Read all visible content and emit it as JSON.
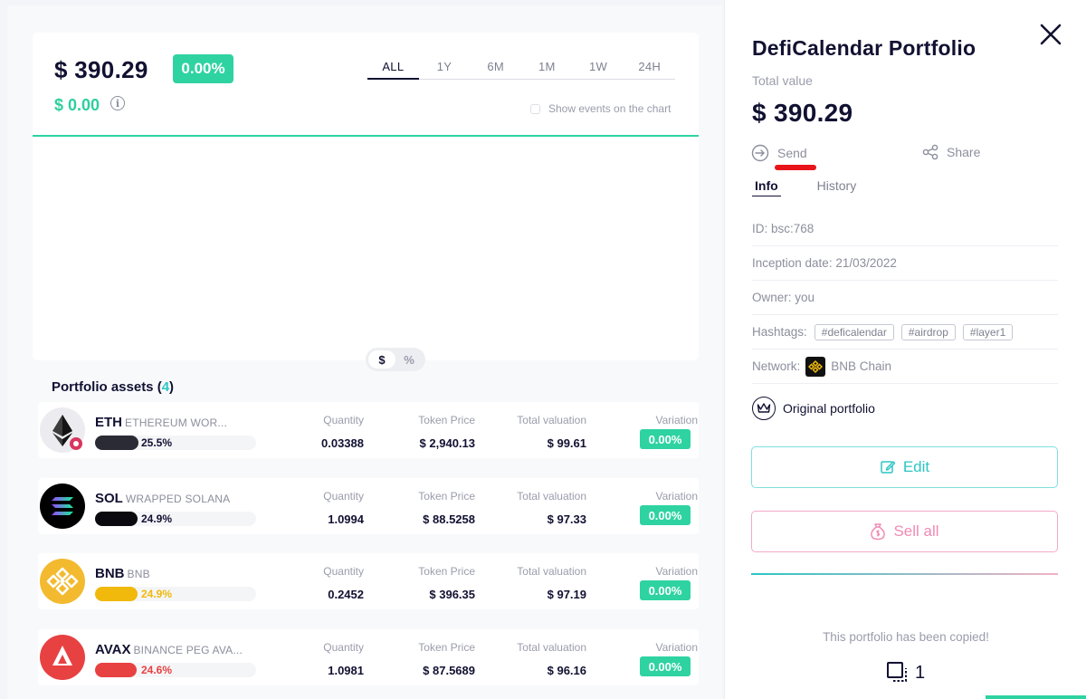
{
  "header": {
    "total_value": "$ 390.29",
    "change_pct": "0.00%",
    "change_value": "$ 0.00",
    "info_glyph": "i",
    "ranges": [
      "ALL",
      "1Y",
      "6M",
      "1M",
      "1W",
      "24H"
    ],
    "active_range": "ALL",
    "show_events_label": "Show events on the chart",
    "currency_toggle": [
      "$",
      "%"
    ],
    "active_toggle": "$"
  },
  "assets": {
    "title": "Portfolio assets",
    "count": "4",
    "col_labels": {
      "quantity": "Quantity",
      "token_price": "Token Price",
      "total_valuation": "Total valuation",
      "variation": "Variation"
    },
    "rows": [
      {
        "symbol": "ETH",
        "name": "ETHEREUM WOR...",
        "share": "25.5%",
        "share_value": 0.255,
        "share_color": "#2b2b36",
        "pct_color": "#111132",
        "quantity": "0.03388",
        "token_price": "$ 2,940.13",
        "total_valuation": "$ 99.61",
        "variation": "0.00%",
        "logo_icon": "ethereum-icon",
        "logo_bg": "#ececf0"
      },
      {
        "symbol": "SOL",
        "name": "WRAPPED SOLANA",
        "share": "24.9%",
        "share_value": 0.249,
        "share_color": "#0a0a0f",
        "pct_color": "#111132",
        "quantity": "1.0994",
        "token_price": "$ 88.5258",
        "total_valuation": "$ 97.33",
        "variation": "0.00%",
        "logo_icon": "solana-icon",
        "logo_bg": "#000000"
      },
      {
        "symbol": "BNB",
        "name": "BNB",
        "share": "24.9%",
        "share_value": 0.249,
        "share_color": "#f0b90b",
        "pct_color": "#f0b90b",
        "quantity": "0.2452",
        "token_price": "$ 396.35",
        "total_valuation": "$ 97.19",
        "variation": "0.00%",
        "logo_icon": "bnb-icon",
        "logo_bg": "#f3ba2f"
      },
      {
        "symbol": "AVAX",
        "name": "BINANCE PEG AVA...",
        "share": "24.6%",
        "share_value": 0.246,
        "share_color": "#e84142",
        "pct_color": "#e84142",
        "quantity": "1.0981",
        "token_price": "$ 87.5689",
        "total_valuation": "$ 96.16",
        "variation": "0.00%",
        "logo_icon": "avalanche-icon",
        "logo_bg": "#e84142"
      }
    ]
  },
  "panel": {
    "title": "DefiCalendar Portfolio",
    "total_label": "Total value",
    "total_value": "$ 390.29",
    "send_label": "Send",
    "share_label": "Share",
    "tabs": [
      "Info",
      "History"
    ],
    "info_rows": {
      "id": "ID: bsc:768",
      "inception": "Inception date: 21/03/2022",
      "owner": "Owner: you",
      "hashtags_label": "Hashtags:",
      "hashtags": [
        "#deficalendar",
        "#airdrop",
        "#layer1"
      ],
      "network_label": "Network:",
      "network": "BNB Chain"
    },
    "original_label": "Original portfolio",
    "edit_label": "Edit",
    "sell_label": "Sell all",
    "copied_text": "This portfolio has been copied!",
    "copies_count": "1"
  },
  "colors": {
    "accent_green": "#2ed3a1",
    "accent_teal": "#2bc6c4",
    "accent_pink": "#f18ab4",
    "annotation_red": "#e8141a"
  }
}
